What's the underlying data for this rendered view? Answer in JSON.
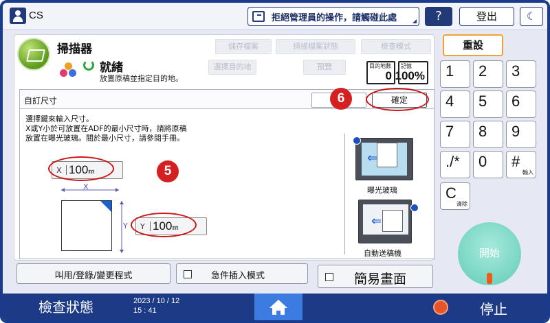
{
  "topbar": {
    "user_name": "CS",
    "message_button": "拒絕管理員的操作，請觸碰此處",
    "help_label": "?",
    "logout_label": "登出",
    "moon_label": "☾"
  },
  "app": {
    "title": "掃描器",
    "ghost_buttons": [
      "儲存檔案",
      "掃描檔案狀態",
      "檢查模式",
      "選擇目的地",
      "預覽"
    ],
    "status_title": "就緒",
    "status_sub": "放置原稿並指定目的地。",
    "counter_dest_label": "目的地數",
    "counter_dest_value": "0",
    "counter_memory_label": "記憶",
    "counter_memory_value": "100%"
  },
  "dialog": {
    "title": "自訂尺寸",
    "ok_label": "確定",
    "instructions": [
      "選擇鍵來輸入尺寸。",
      "X或Y小於可放置在ADF的最小尺寸時，請將原稿",
      "放置在曝光玻璃。關於最小尺寸，請參閱手冊。"
    ],
    "x_axis": "X",
    "x_value": "100",
    "y_axis": "Y",
    "y_value": "100",
    "unit": "㎜",
    "diagram_x": "X",
    "diagram_y": "Y",
    "source_glass": "曝光玻璃",
    "source_adf": "自動送稿機"
  },
  "annotations": {
    "badge_5": "5",
    "badge_6": "6",
    "red_color": "#cc1515"
  },
  "bottom_buttons": {
    "program": "叫用/登錄/變更程式",
    "interrupt": "急件插入模式",
    "simple": "簡易畫面"
  },
  "keypad": {
    "reset": "重設",
    "keys": [
      {
        "n": "1",
        "sub": ""
      },
      {
        "n": "2",
        "sub": ""
      },
      {
        "n": "3",
        "sub": ""
      },
      {
        "n": "4",
        "sub": ""
      },
      {
        "n": "5",
        "sub": ""
      },
      {
        "n": "6",
        "sub": ""
      },
      {
        "n": "7",
        "sub": ""
      },
      {
        "n": "8",
        "sub": ""
      },
      {
        "n": "9",
        "sub": ""
      },
      {
        "n": "./*",
        "sub": ""
      },
      {
        "n": "0",
        "sub": ""
      },
      {
        "n": "#",
        "sub": "輸入"
      },
      {
        "n": "C",
        "sub": "清除"
      }
    ],
    "start": "開始"
  },
  "statusbar": {
    "check_status": "檢查狀態",
    "date": "2023 / 10 / 12",
    "time": "15 : 41",
    "stop": "停止"
  },
  "colors": {
    "frame": "#1a3a8c",
    "statusbar": "#1c3a86",
    "home": "#3c7be0",
    "start": "#74d3c0",
    "reset_border": "#f0a030"
  }
}
